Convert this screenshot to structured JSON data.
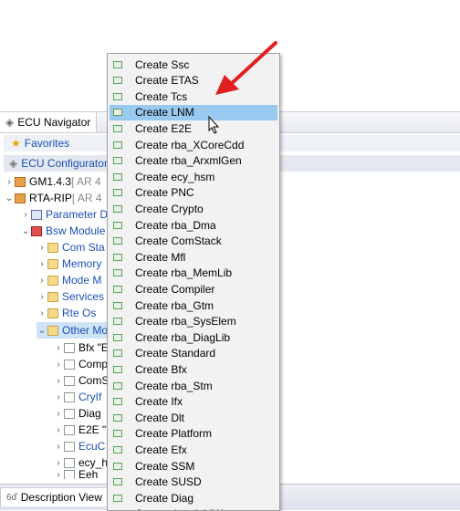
{
  "nav": {
    "tab_title": "ECU Navigator",
    "favorites": "Favorites",
    "ecu_config": "ECU Configurator",
    "tree": [
      {
        "label": "GM1.4.3",
        "suffix": " [ AR 4"
      },
      {
        "label": "RTA-RIP",
        "suffix": " [ AR 4"
      },
      {
        "label": "Parameter D"
      },
      {
        "label": "Bsw Module"
      },
      {
        "label": "Com Sta"
      },
      {
        "label": "Memory"
      },
      {
        "label": "Mode M"
      },
      {
        "label": "Services"
      },
      {
        "label": "Rte Os"
      },
      {
        "label": "Other Mo"
      },
      {
        "label": "Bfx \"E"
      },
      {
        "label": "Comp"
      },
      {
        "label": "ComS"
      },
      {
        "label": "CryIf"
      },
      {
        "label": "Diag"
      },
      {
        "label": "E2E \""
      },
      {
        "label": "EcuC"
      },
      {
        "label": "ecy_h"
      },
      {
        "label": "Eeh"
      }
    ]
  },
  "bottom": {
    "tab_title": "Description View"
  },
  "menu": {
    "items": [
      "Create Ssc",
      "Create ETAS",
      "Create Tcs",
      "Create LNM",
      "Create E2E",
      "Create rba_XCoreCdd",
      "Create rba_ArxmlGen",
      "Create ecy_hsm",
      "Create PNC",
      "Create Crypto",
      "Create rba_Dma",
      "Create ComStack",
      "Create Mfl",
      "Create rba_MemLib",
      "Create Compiler",
      "Create rba_Gtm",
      "Create rba_SysElem",
      "Create rba_DiagLib",
      "Create Standard",
      "Create Bfx",
      "Create rba_Stm",
      "Create Ifx",
      "Create Dlt",
      "Create Platform",
      "Create Efx",
      "Create SSM",
      "Create SUSD",
      "Create Diag",
      "Create rba_AddW"
    ],
    "selected_index": 3
  },
  "colors": {
    "selection": "#99c9ef",
    "arrow": "#e02020",
    "link_blue": "#1b4fb5"
  }
}
